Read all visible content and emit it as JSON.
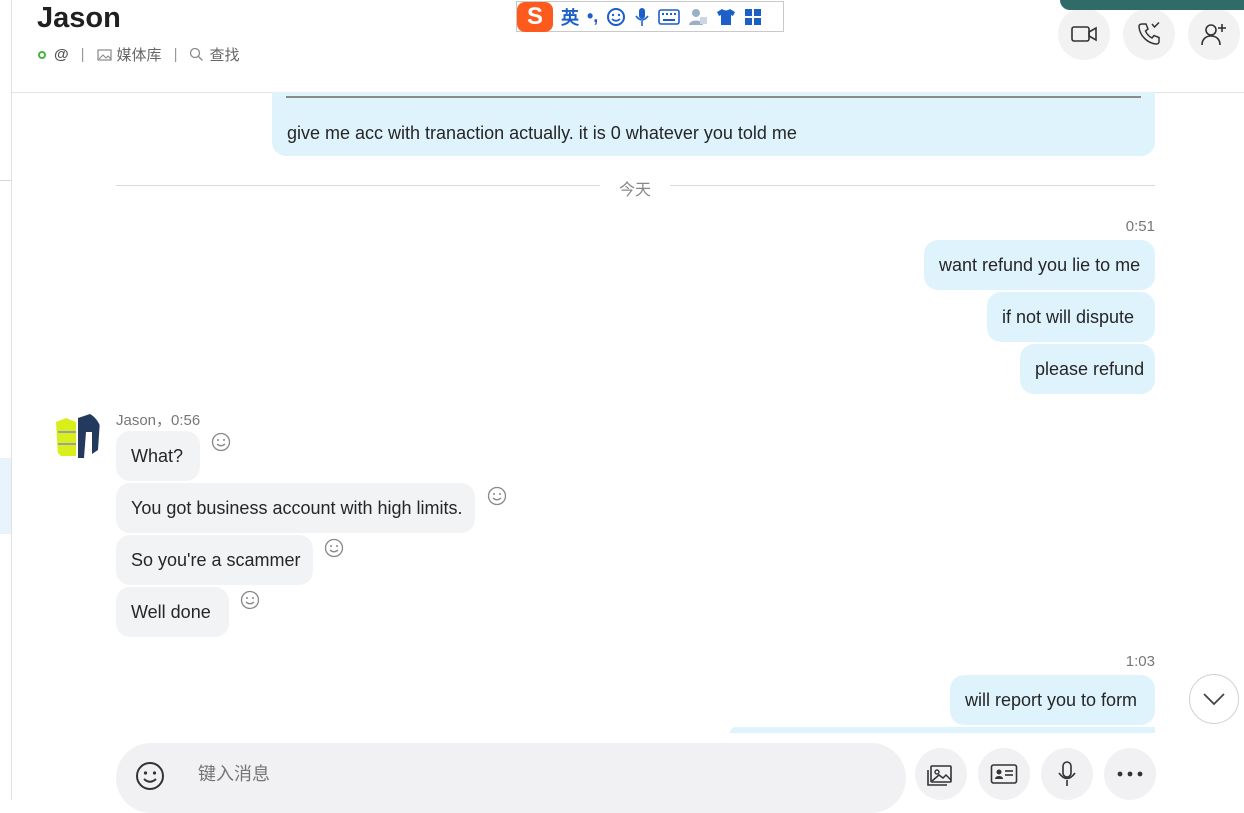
{
  "header": {
    "contact_name": "Jason",
    "at_symbol": "@",
    "media_label": "媒体库",
    "search_label": "查找"
  },
  "ime": {
    "logo": "S",
    "lang": "英",
    "punct": "•,"
  },
  "messages": {
    "prev_tail": "give me acc with tranaction actually. it is 0 whatever you told me",
    "day_divider": "今天",
    "out_time_1": "0:51",
    "out_1": "want refund you lie to me",
    "out_2": "if not  will dispute",
    "out_3": "please refund",
    "in_header": "Jason，0:56",
    "in_1": "What?",
    "in_2": "You got business account with high limits.",
    "in_3": "So you're a scammer",
    "in_4": "Well done",
    "out_time_2": "1:03",
    "out_4": "will report you to form"
  },
  "composer": {
    "placeholder": "键入消息"
  },
  "colors": {
    "outgoing_bubble": "#dff3fd",
    "incoming_bubble": "#f2f3f5",
    "status_online": "#44b544",
    "ime_brand": "#ff5a1e",
    "ime_blue": "#1d5fc9"
  },
  "icons": {
    "video": "video-call-icon",
    "call": "phone-call-icon",
    "add_person": "add-person-icon",
    "media": "media-gallery-icon",
    "search": "search-icon",
    "emoji": "emoji-icon",
    "attach": "image-attach-icon",
    "contact_card": "contact-card-icon",
    "mic": "microphone-icon",
    "more": "more-icon",
    "chevron": "chevron-down-icon"
  }
}
